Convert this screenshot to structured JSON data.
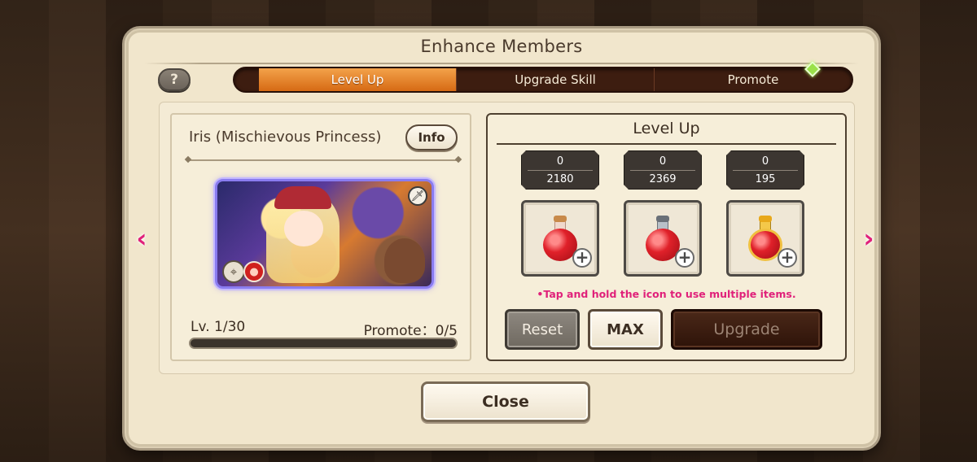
{
  "panel": {
    "title": "Enhance Members",
    "help_label": "?"
  },
  "tabs": [
    {
      "label": "Level Up",
      "active": true
    },
    {
      "label": "Upgrade Skill",
      "active": false
    },
    {
      "label": "Promote",
      "active": false
    }
  ],
  "character": {
    "name": "Iris (Mischievous Princess)",
    "info_label": "Info",
    "level_text": "Lv. 1/30",
    "promote_text": "Promote：0/5",
    "exp_progress": 0
  },
  "level_up": {
    "title": "Level Up",
    "items": [
      {
        "selected": "0",
        "owned": "2180",
        "icon": "small-red-potion-icon"
      },
      {
        "selected": "0",
        "owned": "2369",
        "icon": "medium-red-potion-icon"
      },
      {
        "selected": "0",
        "owned": "195",
        "icon": "large-gold-potion-icon"
      }
    ],
    "hint": "•Tap and hold the icon to use multiple items.",
    "reset_label": "Reset",
    "max_label": "MAX",
    "upgrade_label": "Upgrade"
  },
  "footer": {
    "close_label": "Close"
  },
  "nav": {
    "prev_glyph": "‹",
    "next_glyph": "›"
  },
  "colors": {
    "accent_orange": "#e07a1e",
    "hint_pink": "#e0217a",
    "panel_bg": "#f1e6cc"
  }
}
